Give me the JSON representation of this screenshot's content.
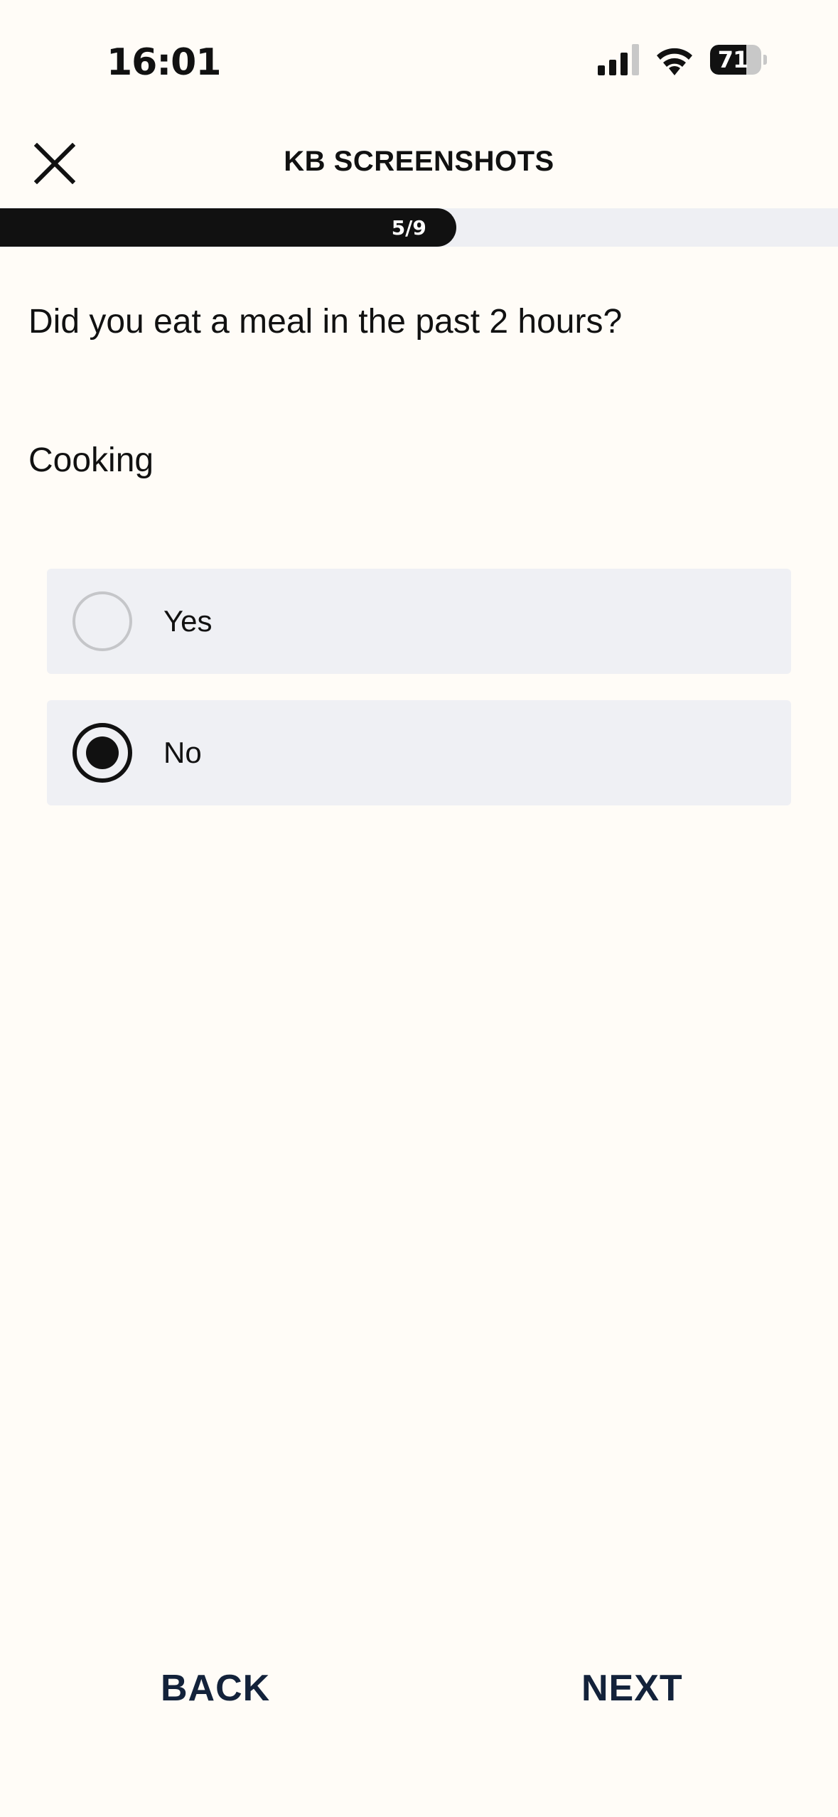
{
  "status_bar": {
    "time": "16:01",
    "battery_level": "71",
    "battery_fraction": 0.71,
    "icons": [
      "signal-icon",
      "wifi-icon",
      "battery-icon"
    ]
  },
  "header": {
    "title": "KB SCREENSHOTS",
    "close_icon": "close-icon"
  },
  "progress": {
    "label": "5/9",
    "current": 5,
    "total": 9
  },
  "question": {
    "text": "Did you eat a meal in the past 2 hours?",
    "category": "Cooking"
  },
  "options": [
    {
      "label": "Yes",
      "selected": false
    },
    {
      "label": "No",
      "selected": true
    }
  ],
  "footer": {
    "back_label": "BACK",
    "next_label": "NEXT"
  },
  "colors": {
    "background": "#fffcf7",
    "primary": "#111111",
    "option_bg": "#eff0f4",
    "footer_text": "#13223a"
  }
}
